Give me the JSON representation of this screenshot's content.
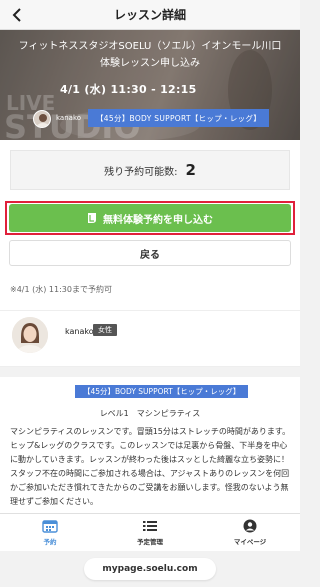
{
  "navbar": {
    "title": "レッスン詳細",
    "back_icon": "chevron-left-icon"
  },
  "hero": {
    "studio_line": "フィットネススタジオSOELU（ソエル）イオンモール川口",
    "subtitle": "体験レッスン申し込み",
    "datetime": "4/1 (水) 11:30 - 12:15",
    "watermark": "LIVE STUDIO",
    "instructor_name": "kanako",
    "lesson_badge": "【45分】BODY SUPPORT【ヒップ・レッグ】"
  },
  "booking": {
    "remaining_label": "残り予約可能数:",
    "remaining_value": "2",
    "cta_label": "無料体験予約を申し込む",
    "cta_icon": "leaf-icon",
    "back_label": "戻る",
    "deadline": "※4/1 (水) 11:30まで予約可",
    "cta_color": "#6bbf4e",
    "highlight_color": "#e0203a"
  },
  "instructor": {
    "name": "kanako",
    "gender_badge": "女性"
  },
  "description": {
    "badge": "【45分】BODY SUPPORT【ヒップ・レッグ】",
    "level": "レベル1　マシンピラティス",
    "body": "マシンピラティスのレッスンです。冒頭15分はストレッチの時間があります。ヒップ&レッグのクラスです。このレッスンでは足裏から骨盤、下半身を中心に動かしていきます。レッスンが終わった後はスッとした綺麗な立ち姿勢に！スタッフ不在の時間にご参加される場合は、アジャストありのレッスンを何回かご参加いただき慣れてきたからのご受講をお願いします。怪我のないよう無理せずご参加ください。"
  },
  "tabbar": {
    "tabs": [
      {
        "label": "予約",
        "icon": "calendar-icon",
        "active": true
      },
      {
        "label": "予定管理",
        "icon": "list-icon",
        "active": false
      },
      {
        "label": "マイページ",
        "icon": "user-icon",
        "active": false
      }
    ],
    "active_color": "#4a8fd8"
  },
  "browser": {
    "url": "mypage.soelu.com"
  }
}
